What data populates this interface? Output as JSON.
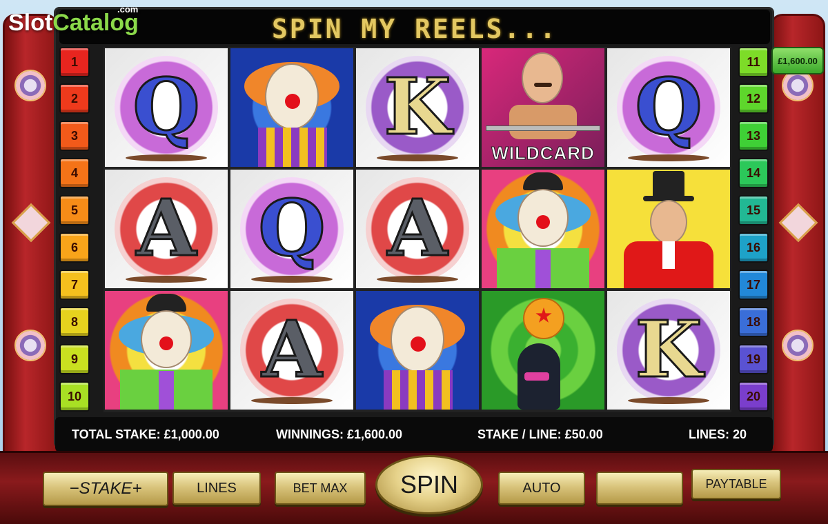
{
  "watermark": {
    "part1": "Slot",
    "part2": "Catalog",
    "suffix": ".com"
  },
  "header": {
    "title": "SPIN MY REELS..."
  },
  "paylines_left": [
    "1",
    "2",
    "3",
    "4",
    "5",
    "6",
    "7",
    "8",
    "9",
    "10"
  ],
  "paylines_right": [
    "11",
    "12",
    "13",
    "14",
    "15",
    "16",
    "17",
    "18",
    "19",
    "20"
  ],
  "win_badge": "£1,600.00",
  "reels": {
    "row1": [
      "Q",
      "clown-red-hair",
      "K",
      "strongman-wildcard",
      "Q"
    ],
    "row2": [
      "A",
      "Q",
      "A",
      "clown-bowler",
      "ringmaster"
    ],
    "row3": [
      "clown-bowler",
      "A",
      "clown-red-hair",
      "seal-ball",
      "K"
    ],
    "wild_label": "WILDCARD"
  },
  "info": {
    "total_stake": "TOTAL STAKE: £1,000.00",
    "winnings": "WINNINGS: £1,600.00",
    "stake_line": "STAKE / LINE: £50.00",
    "lines": "LINES: 20"
  },
  "buttons": {
    "stake": "−STAKE+",
    "lines": "LINES",
    "bet_max": "BET MAX",
    "spin": "SPIN",
    "auto": "AUTO",
    "blank": "",
    "paytable": "PAYTABLE"
  }
}
